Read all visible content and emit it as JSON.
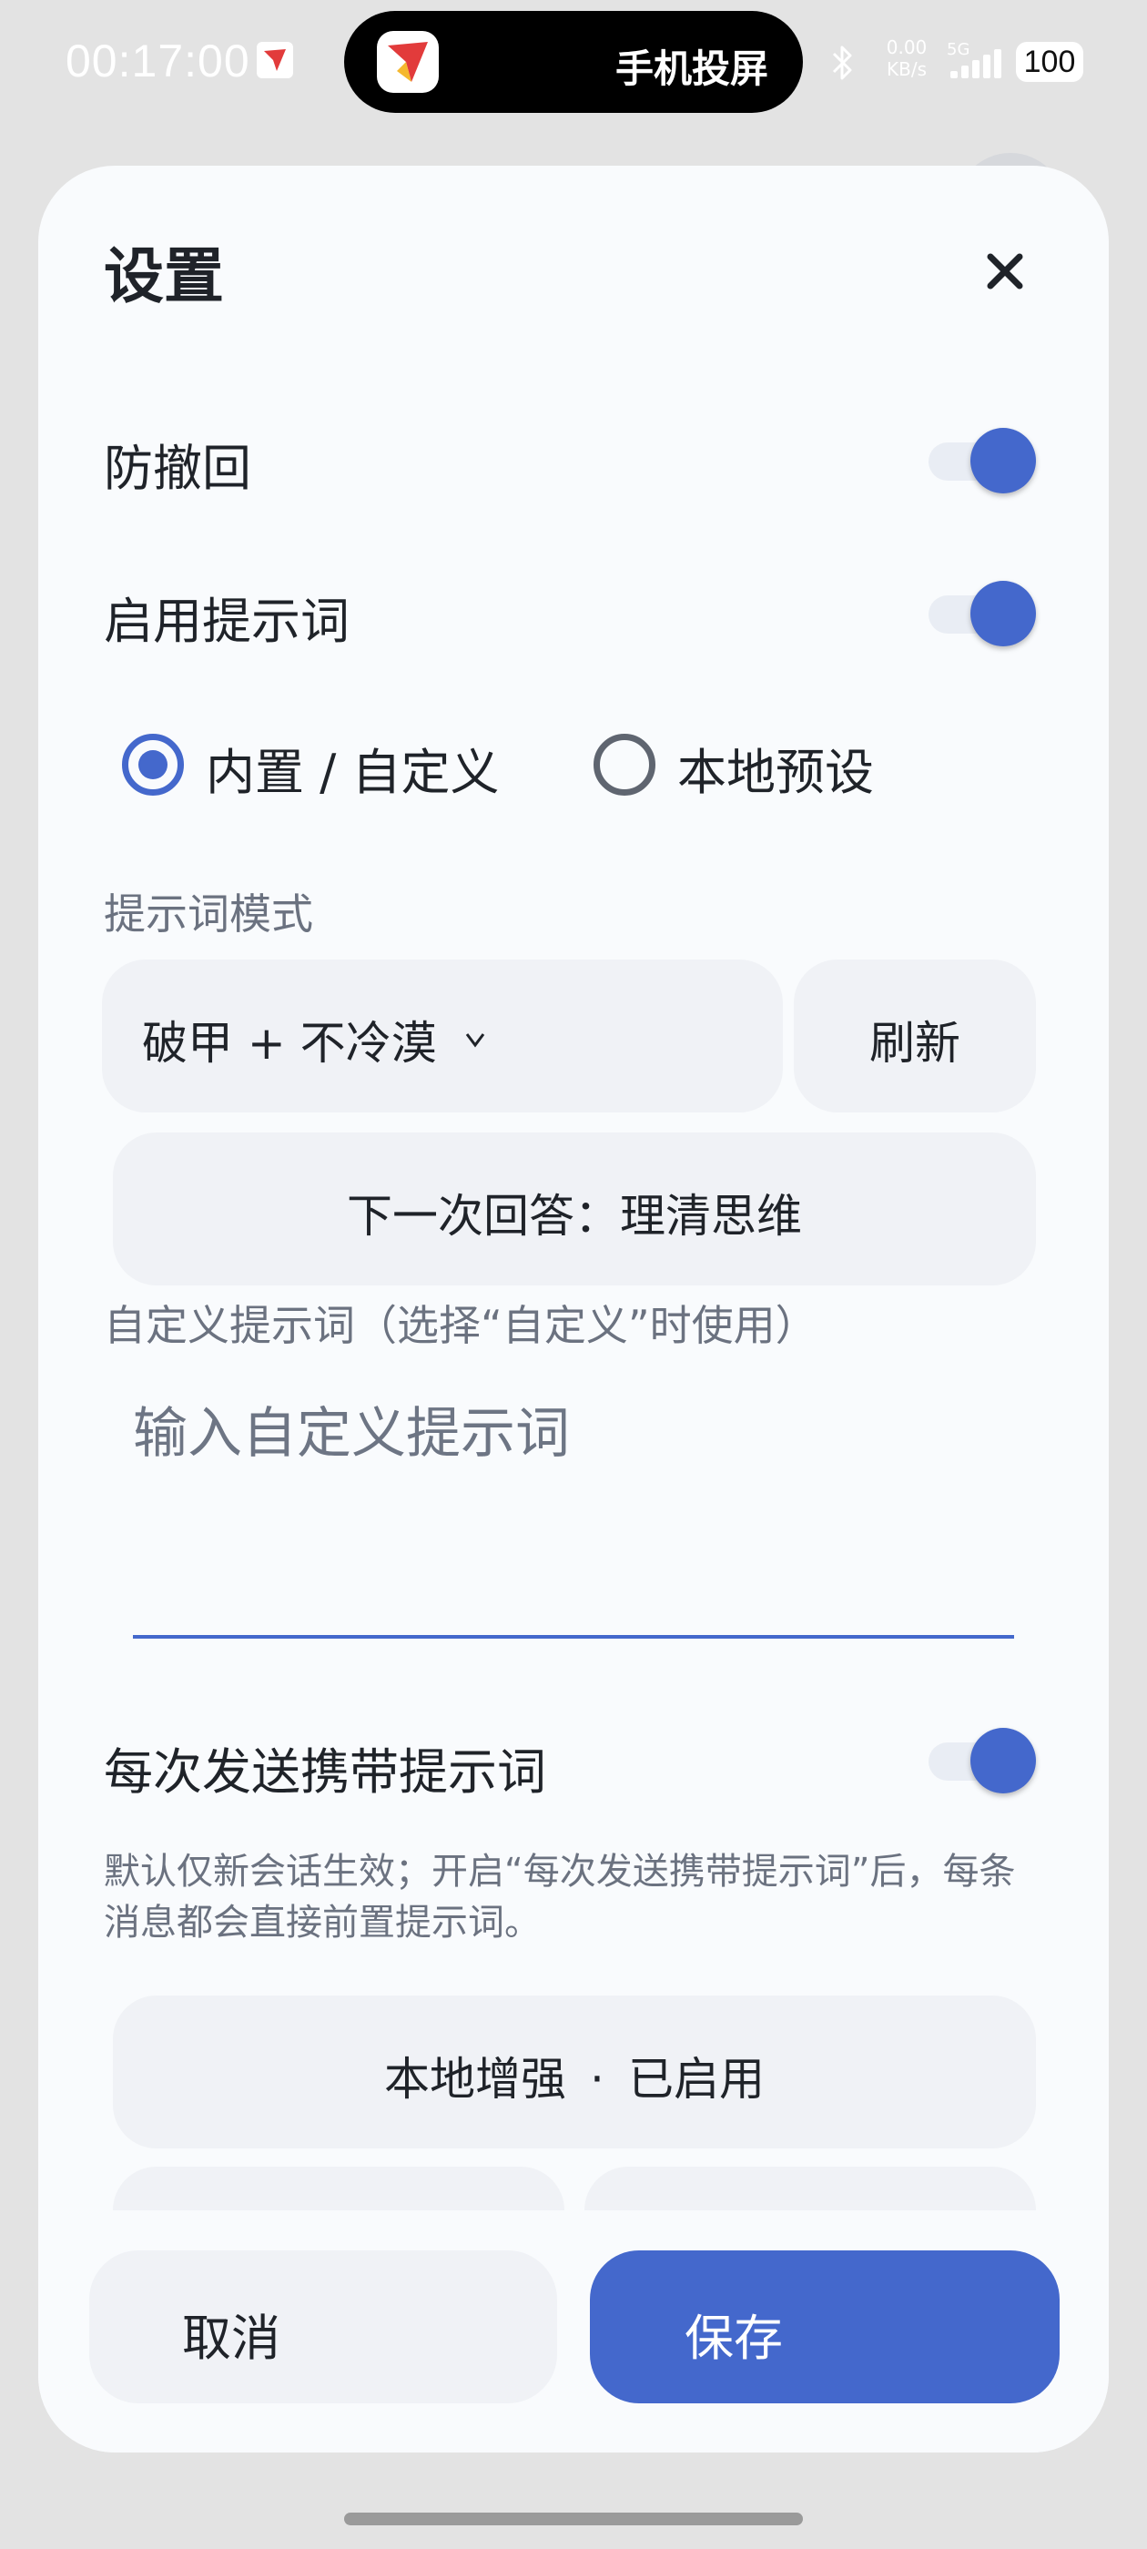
{
  "status_bar": {
    "time": "00:17:00",
    "island_label": "手机投屏",
    "net_speed_value": "0.00",
    "net_speed_unit": "KB/s",
    "network_type": "5G",
    "battery": "100"
  },
  "dialog": {
    "title": "设置",
    "anti_recall": {
      "label": "防撤回",
      "enabled": true
    },
    "enable_prompt": {
      "label": "启用提示词",
      "enabled": true
    },
    "prompt_source": {
      "options": [
        "内置 / 自定义",
        "本地预设"
      ],
      "selected": "内置 / 自定义"
    },
    "prompt_mode": {
      "label": "提示词模式",
      "selected_value": "破甲 + 不冷漠",
      "chevron": "v",
      "refresh_label": "刷新"
    },
    "next_answer_label": "下一次回答：理清思维",
    "custom_prompt": {
      "label": "自定义提示词（选择“自定义”时使用）",
      "value": "",
      "placeholder": "输入自定义提示词"
    },
    "carry_prompt": {
      "label": "每次发送携带提示词",
      "enabled": true
    },
    "hint": "默认仅新会话生效；开启“每次发送携带提示词”后，每条消息都会直接前置提示词。",
    "local_enhance": {
      "name": "本地增强",
      "separator": "·",
      "status": "已启用"
    },
    "cancel_label": "取消",
    "save_label": "保存"
  },
  "colors": {
    "accent": "#4468cc",
    "surface": "#f9fbfd",
    "button_bg": "#f0f2f6",
    "muted_text": "#6b7280"
  }
}
